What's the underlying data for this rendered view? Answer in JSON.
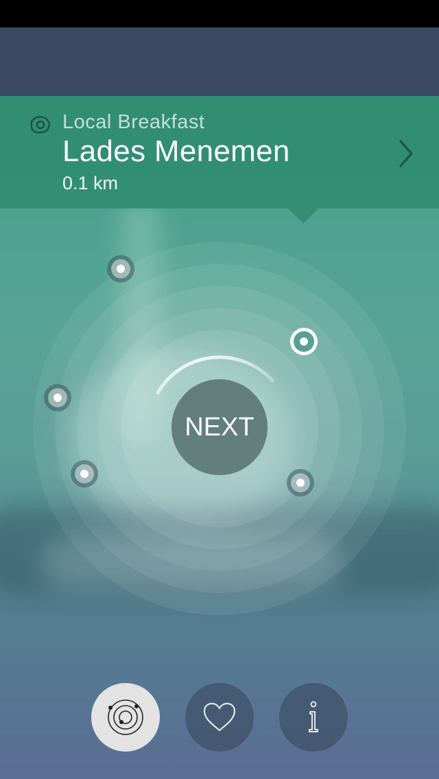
{
  "header": {
    "category": "Local Breakfast",
    "category_icon": "egg-icon",
    "place_name": "Lades Menemen",
    "distance": "0.1 km",
    "detail_icon": "chevron-right-icon"
  },
  "radar": {
    "center_button_label": "NEXT",
    "progress": 0.3,
    "selected_place_index": 1
  },
  "tabs": [
    {
      "name": "radar",
      "icon": "radar-icon",
      "active": true
    },
    {
      "name": "favorites",
      "icon": "heart-icon",
      "active": false
    },
    {
      "name": "info",
      "icon": "info-icon",
      "active": false
    }
  ],
  "colors": {
    "nav_bar": "#3b4a62",
    "info_bar": "#2f8c6e",
    "active_tab": "#e3e3e3"
  }
}
